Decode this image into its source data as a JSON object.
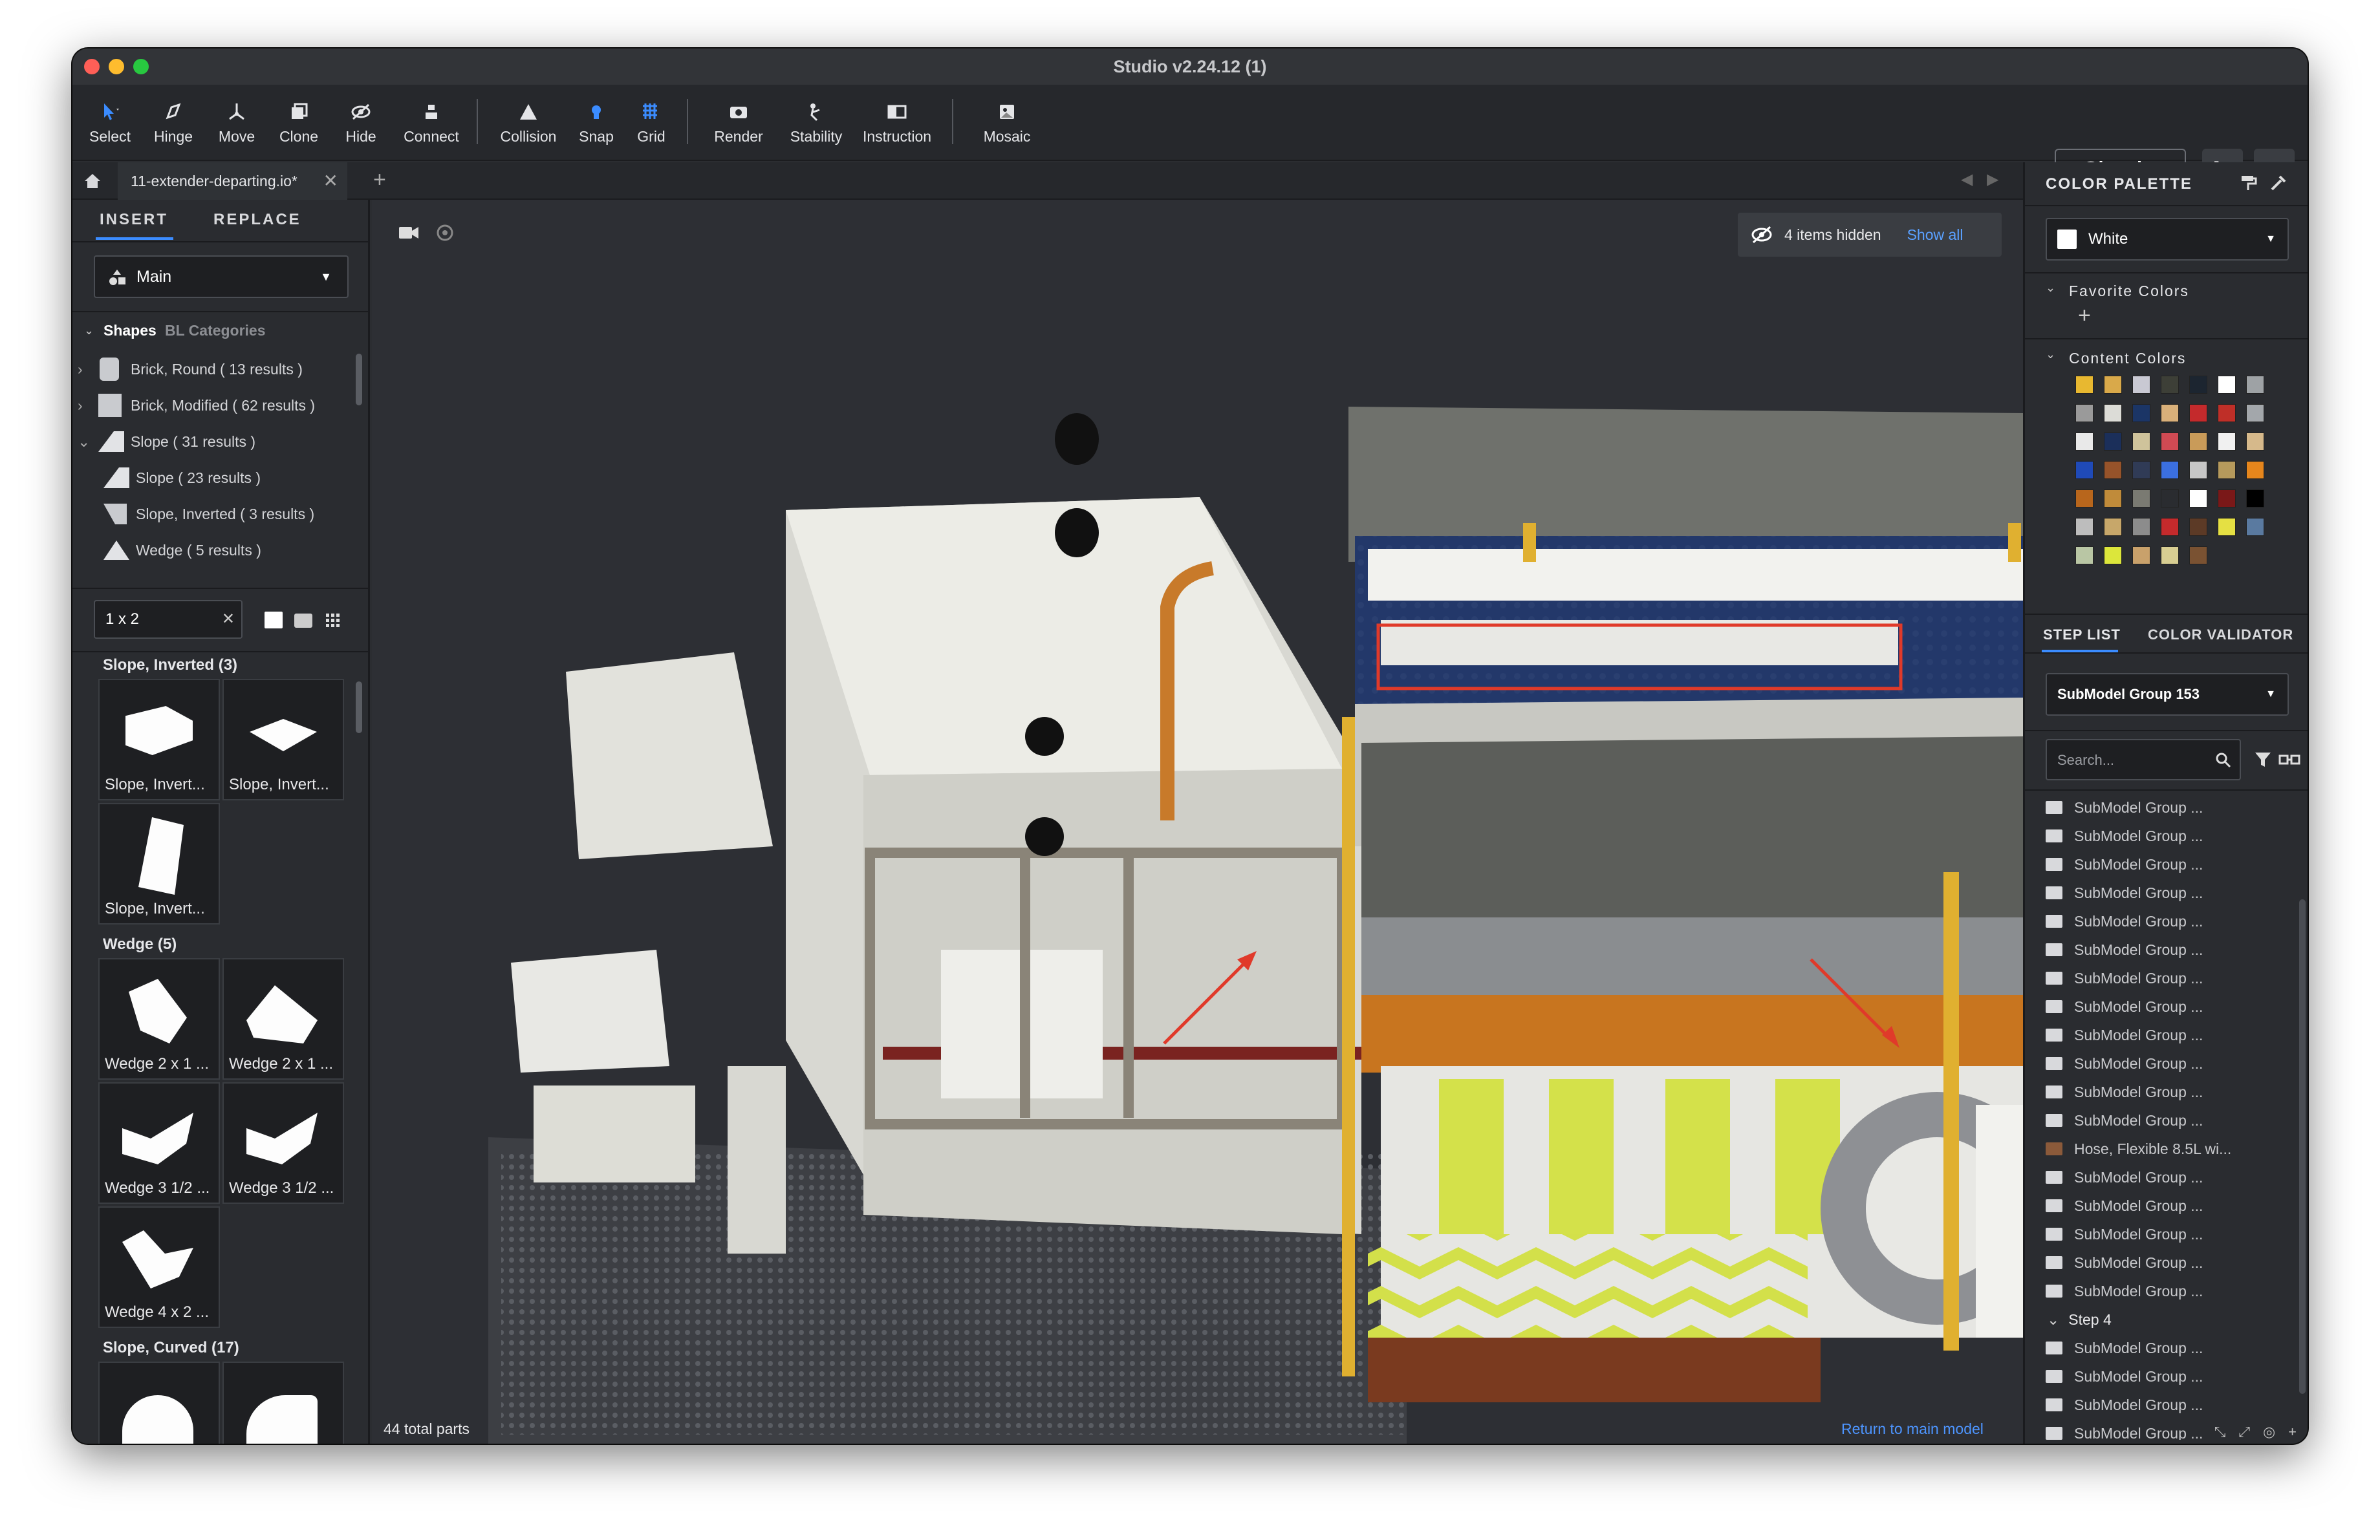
{
  "window": {
    "title": "Studio v2.24.12 (1)"
  },
  "toolbar": {
    "tools": [
      {
        "label": "Select",
        "icon": "select-arrow-icon"
      },
      {
        "label": "Hinge",
        "icon": "hinge-icon"
      },
      {
        "label": "Move",
        "icon": "move-icon"
      },
      {
        "label": "Clone",
        "icon": "clone-icon"
      },
      {
        "label": "Hide",
        "icon": "hide-eye-icon"
      },
      {
        "label": "Connect",
        "icon": "connect-icon"
      },
      {
        "label": "Collision",
        "icon": "collision-icon"
      },
      {
        "label": "Snap",
        "icon": "snap-icon"
      },
      {
        "label": "Grid",
        "icon": "grid-icon"
      },
      {
        "label": "Render",
        "icon": "camera-icon"
      },
      {
        "label": "Stability",
        "icon": "stability-icon"
      },
      {
        "label": "Instruction",
        "icon": "instruction-icon"
      },
      {
        "label": "Mosaic",
        "icon": "mosaic-icon"
      }
    ],
    "sign_in": "Sign in"
  },
  "tabs": {
    "active": "11-extender-departing.io*"
  },
  "left_panel": {
    "tabs": [
      "INSERT",
      "REPLACE"
    ],
    "palette_select": "Main",
    "shapes_label": "Shapes",
    "bl_label": "BL Categories",
    "shape_tree": [
      "Brick, Round ( 13 results )",
      "Brick, Modified ( 62 results )",
      "Slope ( 31 results )",
      "Slope ( 23 results )",
      "Slope, Inverted ( 3 results )",
      "Wedge ( 5 results )"
    ],
    "search_value": "1 x 2",
    "sections": [
      {
        "title": "Slope, Inverted (3)",
        "items": [
          "Slope, Invert...",
          "Slope, Invert...",
          "Slope, Invert..."
        ]
      },
      {
        "title": "Wedge (5)",
        "items": [
          "Wedge 2 x 1 ...",
          "Wedge 2 x 1 ...",
          "Wedge 3 1/2 ...",
          "Wedge 3 1/2 ...",
          "Wedge 4 x 2 ..."
        ]
      },
      {
        "title": "Slope, Curved (17)",
        "items": []
      }
    ]
  },
  "viewport": {
    "hidden_text": "4 items hidden",
    "show_all": "Show all",
    "total_parts": "44 total parts",
    "return_link": "Return to main model",
    "highlight_color": "#e03a2a"
  },
  "right_panel": {
    "palette_title": "COLOR PALETTE",
    "current_color": "White",
    "favorite_colors": "Favorite Colors",
    "content_colors": "Content Colors",
    "swatches": [
      "#e8b830",
      "#d9a94a",
      "#c9c9d3",
      "#3d3f37",
      "#1c2530",
      "#ffffff",
      "#9ea2a5",
      "#9a9a9a",
      "#dcdcd7",
      "#1b3566",
      "#d9b07a",
      "#c42a2c",
      "#bf2f28",
      "#a3a7ab",
      "#e9e9e9",
      "#1b2f5a",
      "#cfc39b",
      "#d04a53",
      "#c99b59",
      "#f0f0f0",
      "#d6b98b",
      "#1f4ab8",
      "#96532a",
      "#303b56",
      "#3b6fe0",
      "#c7c7c7",
      "#b69a5c",
      "#e6861c",
      "#b8661c",
      "#c08b3a",
      "#7a7a72",
      "#2a2c30",
      "#ffffff",
      "#7a1818",
      "#000000",
      "#bdbdbd",
      "#c7a76a",
      "#8c8c8c",
      "#c42a2c",
      "#5c3a26",
      "#e5e043",
      "#5a7aa0",
      "#b9c6a4",
      "#dce63b",
      "#c9a16b",
      "#d8ce92",
      "#7a5232"
    ],
    "step_tabs": [
      "STEP LIST",
      "COLOR VALIDATOR"
    ],
    "submodel_select": "SubModel Group 153",
    "search_placeholder": "Search...",
    "steps": [
      "SubModel Group ...",
      "SubModel Group ...",
      "SubModel Group ...",
      "SubModel Group ...",
      "SubModel Group ...",
      "SubModel Group ...",
      "SubModel Group ...",
      "SubModel Group ...",
      "SubModel Group ...",
      "SubModel Group ...",
      "SubModel Group ...",
      "SubModel Group ...",
      "Hose, Flexible 8.5L wi...",
      "SubModel Group ...",
      "SubModel Group ...",
      "SubModel Group ...",
      "SubModel Group ...",
      "SubModel Group ...",
      "Step 4",
      "SubModel Group ...",
      "SubModel Group ...",
      "SubModel Group ...",
      "SubModel Group ..."
    ]
  }
}
